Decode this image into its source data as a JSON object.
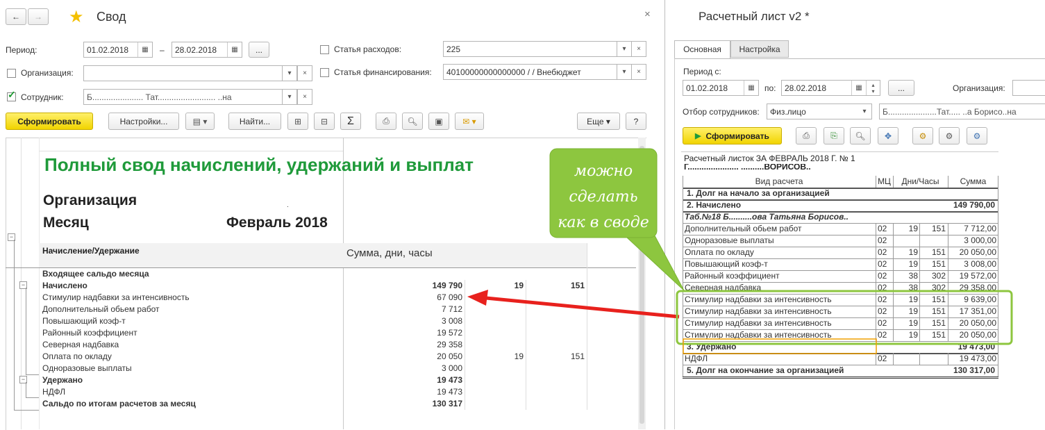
{
  "left": {
    "nav_back": "←",
    "nav_forward": "→",
    "title": "Свод",
    "close": "×",
    "filters": {
      "period_label": "Период:",
      "date_from": "01.02.2018",
      "date_sep": "–",
      "date_to": "28.02.2018",
      "ellipsis": "...",
      "org_label": "Организация:",
      "org_value": "",
      "employee_label": "Сотрудник:",
      "employee_value": "Б...................... Тат......................... ..на",
      "expense_label": "Статья расходов:",
      "expense_value": "225",
      "financing_label": "Статья финансирования:",
      "financing_value": "40100000000000000 /  / Внебюджет"
    },
    "toolbar": {
      "generate": "Сформировать",
      "settings": "Настройки...",
      "find": "Найти...",
      "sigma": "Σ",
      "more": "Еще",
      "help": "?"
    },
    "report": {
      "title": "Полный свод начислений, удержаний и выплат",
      "org_label": "Организация",
      "month_label": "Месяц",
      "month_value": "Февраль 2018",
      "col1_header": "Начисление/Удержание",
      "col2_header": "Сумма, дни, часы",
      "rows": [
        {
          "name": "Входящее сальдо месяца",
          "sum": "",
          "days": "",
          "hours": "",
          "bold": true
        },
        {
          "name": "Начислено",
          "sum": "149 790",
          "days": "19",
          "hours": "151",
          "bold": true
        },
        {
          "name": "Стимулир надбавки за интенсивность",
          "sum": "67 090",
          "days": "",
          "hours": "",
          "bold": false
        },
        {
          "name": "Дополнительный обьем работ",
          "sum": "7 712",
          "days": "",
          "hours": "",
          "bold": false
        },
        {
          "name": "Повышающий коэф-т",
          "sum": "3 008",
          "days": "",
          "hours": "",
          "bold": false
        },
        {
          "name": "Районный коэффициент",
          "sum": "19 572",
          "days": "",
          "hours": "",
          "bold": false
        },
        {
          "name": "Северная надбавка",
          "sum": "29 358",
          "days": "",
          "hours": "",
          "bold": false
        },
        {
          "name": "Оплата по окладу",
          "sum": "20 050",
          "days": "19",
          "hours": "151",
          "bold": false
        },
        {
          "name": "Одноразовые выплаты",
          "sum": "3 000",
          "days": "",
          "hours": "",
          "bold": false
        },
        {
          "name": "Удержано",
          "sum": "19 473",
          "days": "",
          "hours": "",
          "bold": true
        },
        {
          "name": "НДФЛ",
          "sum": "19 473",
          "days": "",
          "hours": "",
          "bold": false
        },
        {
          "name": "Сальдо по итогам расчетов за месяц",
          "sum": "130 317",
          "days": "",
          "hours": "",
          "bold": true
        }
      ]
    }
  },
  "callout": {
    "line1": "можно",
    "line2": "сделать",
    "line3": "как в своде",
    "color": "#8dc63f"
  },
  "right": {
    "title": "Расчетный лист v2 *",
    "tabs": [
      "Основная",
      "Настройка"
    ],
    "period_label": "Период с:",
    "date_from": "01.02.2018",
    "to_label": "по:",
    "date_to": "28.02.2018",
    "ellipsis": "...",
    "org_label": "Организация:",
    "filter_label": "Отбор сотрудников:",
    "filter_value": "Физ.лицо",
    "employee_value": "Б.....................Тат..... ..а Борисо..на",
    "generate": "Сформировать",
    "payslip": {
      "heading": "Расчетный листок ЗА ФЕВРАЛЬ 2018 Г.   № 1",
      "subheading": "Г...................... ..........ВОРИСОВ..",
      "col_name": "Вид расчета",
      "col_mc": "МЦ",
      "col_days": "Дни/Часы",
      "col_sum": "Сумма",
      "sec1": "1. Долг на начало за организацией",
      "sec2": "2. Начислено",
      "sec2_sum": "149 790,00",
      "tab_line": "Таб.№18 Б..........ова Татьяна Борисов..",
      "rows": [
        {
          "name": "Дополнительный обьем работ",
          "mc": "02",
          "days": "19",
          "hours": "151",
          "sum": "7 712,00"
        },
        {
          "name": "Одноразовые выплаты",
          "mc": "02",
          "days": "",
          "hours": "",
          "sum": "3 000,00"
        },
        {
          "name": "Оплата по окладу",
          "mc": "02",
          "days": "19",
          "hours": "151",
          "sum": "20 050,00"
        },
        {
          "name": "Повышающий коэф-т",
          "mc": "02",
          "days": "19",
          "hours": "151",
          "sum": "3 008,00"
        },
        {
          "name": "Районный коэффициент",
          "mc": "02",
          "days": "38",
          "hours": "302",
          "sum": "19 572,00"
        },
        {
          "name": "Северная надбавка",
          "mc": "02",
          "days": "38",
          "hours": "302",
          "sum": "29 358,00"
        },
        {
          "name": "Стимулир надбавки за интенсивность",
          "mc": "02",
          "days": "19",
          "hours": "151",
          "sum": "9 639,00"
        },
        {
          "name": "Стимулир надбавки за интенсивность",
          "mc": "02",
          "days": "19",
          "hours": "151",
          "sum": "17 351,00"
        },
        {
          "name": "Стимулир надбавки за интенсивность",
          "mc": "02",
          "days": "19",
          "hours": "151",
          "sum": "20 050,00"
        },
        {
          "name": "Стимулир надбавки за интенсивность",
          "mc": "02",
          "days": "19",
          "hours": "151",
          "sum": "20 050,00"
        }
      ],
      "sec3": "3. Удержано",
      "sec3_sum": "19 473,00",
      "ndfl_name": "НДФЛ",
      "ndfl_mc": "02",
      "ndfl_sum": "19 473,00",
      "sec5": "5. Долг на окончание за организацией",
      "sec5_sum": "130 317,00"
    }
  },
  "colors": {
    "report_title": "#1f9a3a",
    "highlight": "#8dc63f",
    "arrow": "#e8211d",
    "generate_button": "#f5dc1a"
  }
}
